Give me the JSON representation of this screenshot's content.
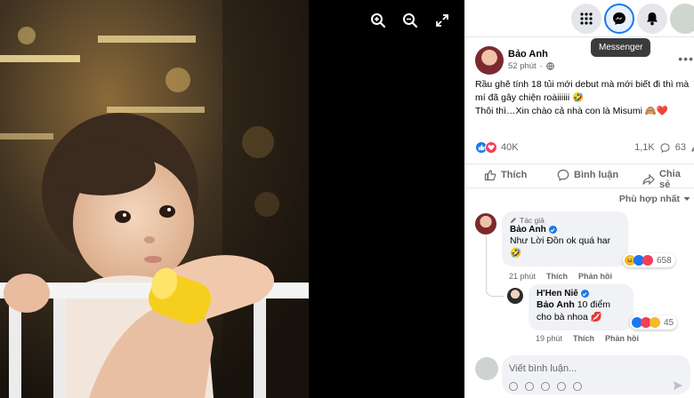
{
  "viewer": {
    "zoom_in_icon": "zoom-in-icon",
    "zoom_out_icon": "zoom-out-icon",
    "fullscreen_icon": "fullscreen-icon"
  },
  "topbar": {
    "menu_icon": "grid-menu-icon",
    "messenger_icon": "messenger-icon",
    "notifications_icon": "bell-icon",
    "tooltip": "Messenger"
  },
  "post": {
    "author": "Bảo Anh",
    "time": "52 phút",
    "text_line1": "Rầu ghê tính 18 tủi mới debut mà mới biết đi thì mà mí đã gây chiện roàiiiiii 🤣",
    "text_line2": "Thôi thì…Xin chào cả nhà con là Misumi 🙈❤️",
    "reaction_count": "40K",
    "comment_count": "1,1K",
    "share_count": "63",
    "like_label": "Thích",
    "comment_label": "Bình luận",
    "share_label": "Chia sẻ",
    "sort_label": "Phù hợp nhất"
  },
  "comments": [
    {
      "badge": "Tác giả",
      "author": "Bảo Anh",
      "text": "Như Lời Đồn ok quá har 🤣",
      "time": "21 phút",
      "like": "Thích",
      "reply": "Phản hồi",
      "reactions": "658"
    },
    {
      "author": "H'Hen Niê",
      "mention": "Bảo Anh",
      "text": "10 điểm cho bà nhoa 💋",
      "time": "19 phút",
      "like": "Thích",
      "reply": "Phản hồi",
      "reactions": "45"
    }
  ],
  "composer": {
    "placeholder": "Viết bình luận..."
  },
  "colors": {
    "brand": "#1877f2",
    "love": "#f33e58",
    "panel_bg": "#ffffff",
    "bubble_bg": "#f0f2f5"
  }
}
